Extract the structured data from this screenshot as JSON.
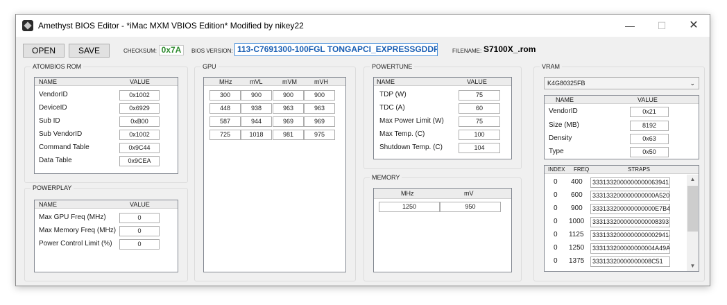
{
  "window": {
    "title": "Amethyst BIOS Editor - *iMac MXM VBIOS Edition* Modified by nikey22"
  },
  "toolbar": {
    "open_label": "OPEN",
    "save_label": "SAVE",
    "checksum_label": "CHECKSUM:",
    "checksum_value": "0x7A",
    "bios_version_label": "BIOS VERSION:",
    "bios_version_value": "113-C7691300-100FGL TONGAPCI_EXPRESSGDDR5",
    "filename_label": "FILENAME:",
    "filename_value": "S7100X_.rom"
  },
  "atombios": {
    "title": "ATOMBIOS ROM",
    "col_name": "NAME",
    "col_value": "VALUE",
    "rows": [
      {
        "name": "VendorID",
        "value": "0x1002"
      },
      {
        "name": "DeviceID",
        "value": "0x6929"
      },
      {
        "name": "Sub ID",
        "value": "0xB00"
      },
      {
        "name": "Sub VendorID",
        "value": "0x1002"
      },
      {
        "name": "Command Table",
        "value": "0x9C44"
      },
      {
        "name": "Data Table",
        "value": "0x9CEA"
      }
    ]
  },
  "powerplay": {
    "title": "POWERPLAY",
    "col_name": "NAME",
    "col_value": "VALUE",
    "rows": [
      {
        "name": "Max GPU Freq (MHz)",
        "value": "0"
      },
      {
        "name": "Max Memory Freq (MHz)",
        "value": "0"
      },
      {
        "name": "Power Control Limit (%)",
        "value": "0"
      }
    ]
  },
  "gpu": {
    "title": "GPU",
    "cols": [
      "MHz",
      "mVL",
      "mVM",
      "mVH"
    ],
    "rows": [
      [
        "300",
        "900",
        "900",
        "900"
      ],
      [
        "448",
        "938",
        "963",
        "963"
      ],
      [
        "587",
        "944",
        "969",
        "969"
      ],
      [
        "725",
        "1018",
        "981",
        "975"
      ]
    ]
  },
  "powertune": {
    "title": "POWERTUNE",
    "col_name": "NAME",
    "col_value": "VALUE",
    "rows": [
      {
        "name": "TDP (W)",
        "value": "75"
      },
      {
        "name": "TDC (A)",
        "value": "60"
      },
      {
        "name": "Max Power Limit (W)",
        "value": "75"
      },
      {
        "name": "Max Temp. (C)",
        "value": "100"
      },
      {
        "name": "Shutdown Temp. (C)",
        "value": "104"
      }
    ]
  },
  "memory": {
    "title": "MEMORY",
    "col_mhz": "MHz",
    "col_mv": "mV",
    "rows": [
      {
        "mhz": "1250",
        "mv": "950"
      }
    ]
  },
  "vram": {
    "title": "VRAM",
    "selected": "K4G80325FB",
    "col_name": "NAME",
    "col_value": "VALUE",
    "rows": [
      {
        "name": "VendorID",
        "value": "0x21"
      },
      {
        "name": "Size (MB)",
        "value": "8192"
      },
      {
        "name": "Density",
        "value": "0x63"
      },
      {
        "name": "Type",
        "value": "0x50"
      }
    ],
    "straps_cols": {
      "index": "INDEX",
      "freq": "FREQ",
      "straps": "STRAPS"
    },
    "straps": [
      {
        "index": "0",
        "freq": "400",
        "value": "3331332000000000063941"
      },
      {
        "index": "0",
        "freq": "600",
        "value": "333133200000000000A520"
      },
      {
        "index": "0",
        "freq": "900",
        "value": "333133200000000000E7B43"
      },
      {
        "index": "0",
        "freq": "1000",
        "value": "3331332000000000008393"
      },
      {
        "index": "0",
        "freq": "1125",
        "value": "33313320000000000029414"
      },
      {
        "index": "0",
        "freq": "1250",
        "value": "333133200000000004A49A"
      },
      {
        "index": "0",
        "freq": "1375",
        "value": "33313320000000008C51"
      }
    ]
  },
  "icons": {
    "app": "amethyst-app-icon",
    "minimize": "minimize-icon",
    "maximize": "maximize-icon",
    "close": "close-icon",
    "dropdown": "chevron-down-icon"
  }
}
